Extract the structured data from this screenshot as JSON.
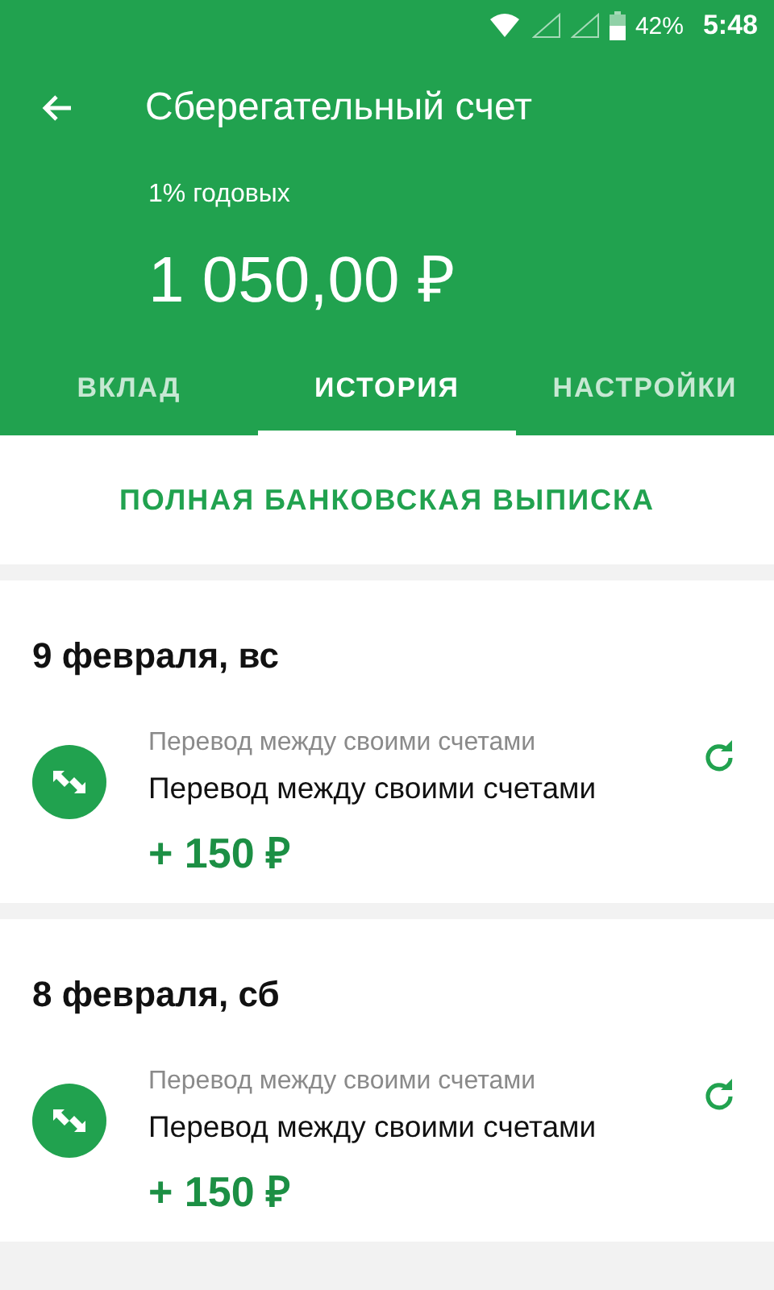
{
  "status_bar": {
    "battery": "42%",
    "time": "5:48"
  },
  "header": {
    "title": "Сберегательный счет",
    "rate": "1% годовых",
    "balance": "1 050,00 ₽"
  },
  "tabs": [
    {
      "label": "ВКЛАД",
      "selected": false
    },
    {
      "label": "ИСТОРИЯ",
      "selected": true
    },
    {
      "label": "НАСТРОЙКИ",
      "selected": false
    }
  ],
  "statement_link": "ПОЛНАЯ БАНКОВСКАЯ ВЫПИСКА",
  "days": [
    {
      "date": "9 февраля, вс",
      "transactions": [
        {
          "category": "Перевод между своими счетами",
          "description": "Перевод между своими счетами",
          "amount": "+ 150 ₽"
        }
      ]
    },
    {
      "date": "8 февраля, сб",
      "transactions": [
        {
          "category": "Перевод между своими счетами",
          "description": "Перевод между своими счетами",
          "amount": "+ 150 ₽"
        }
      ]
    }
  ]
}
